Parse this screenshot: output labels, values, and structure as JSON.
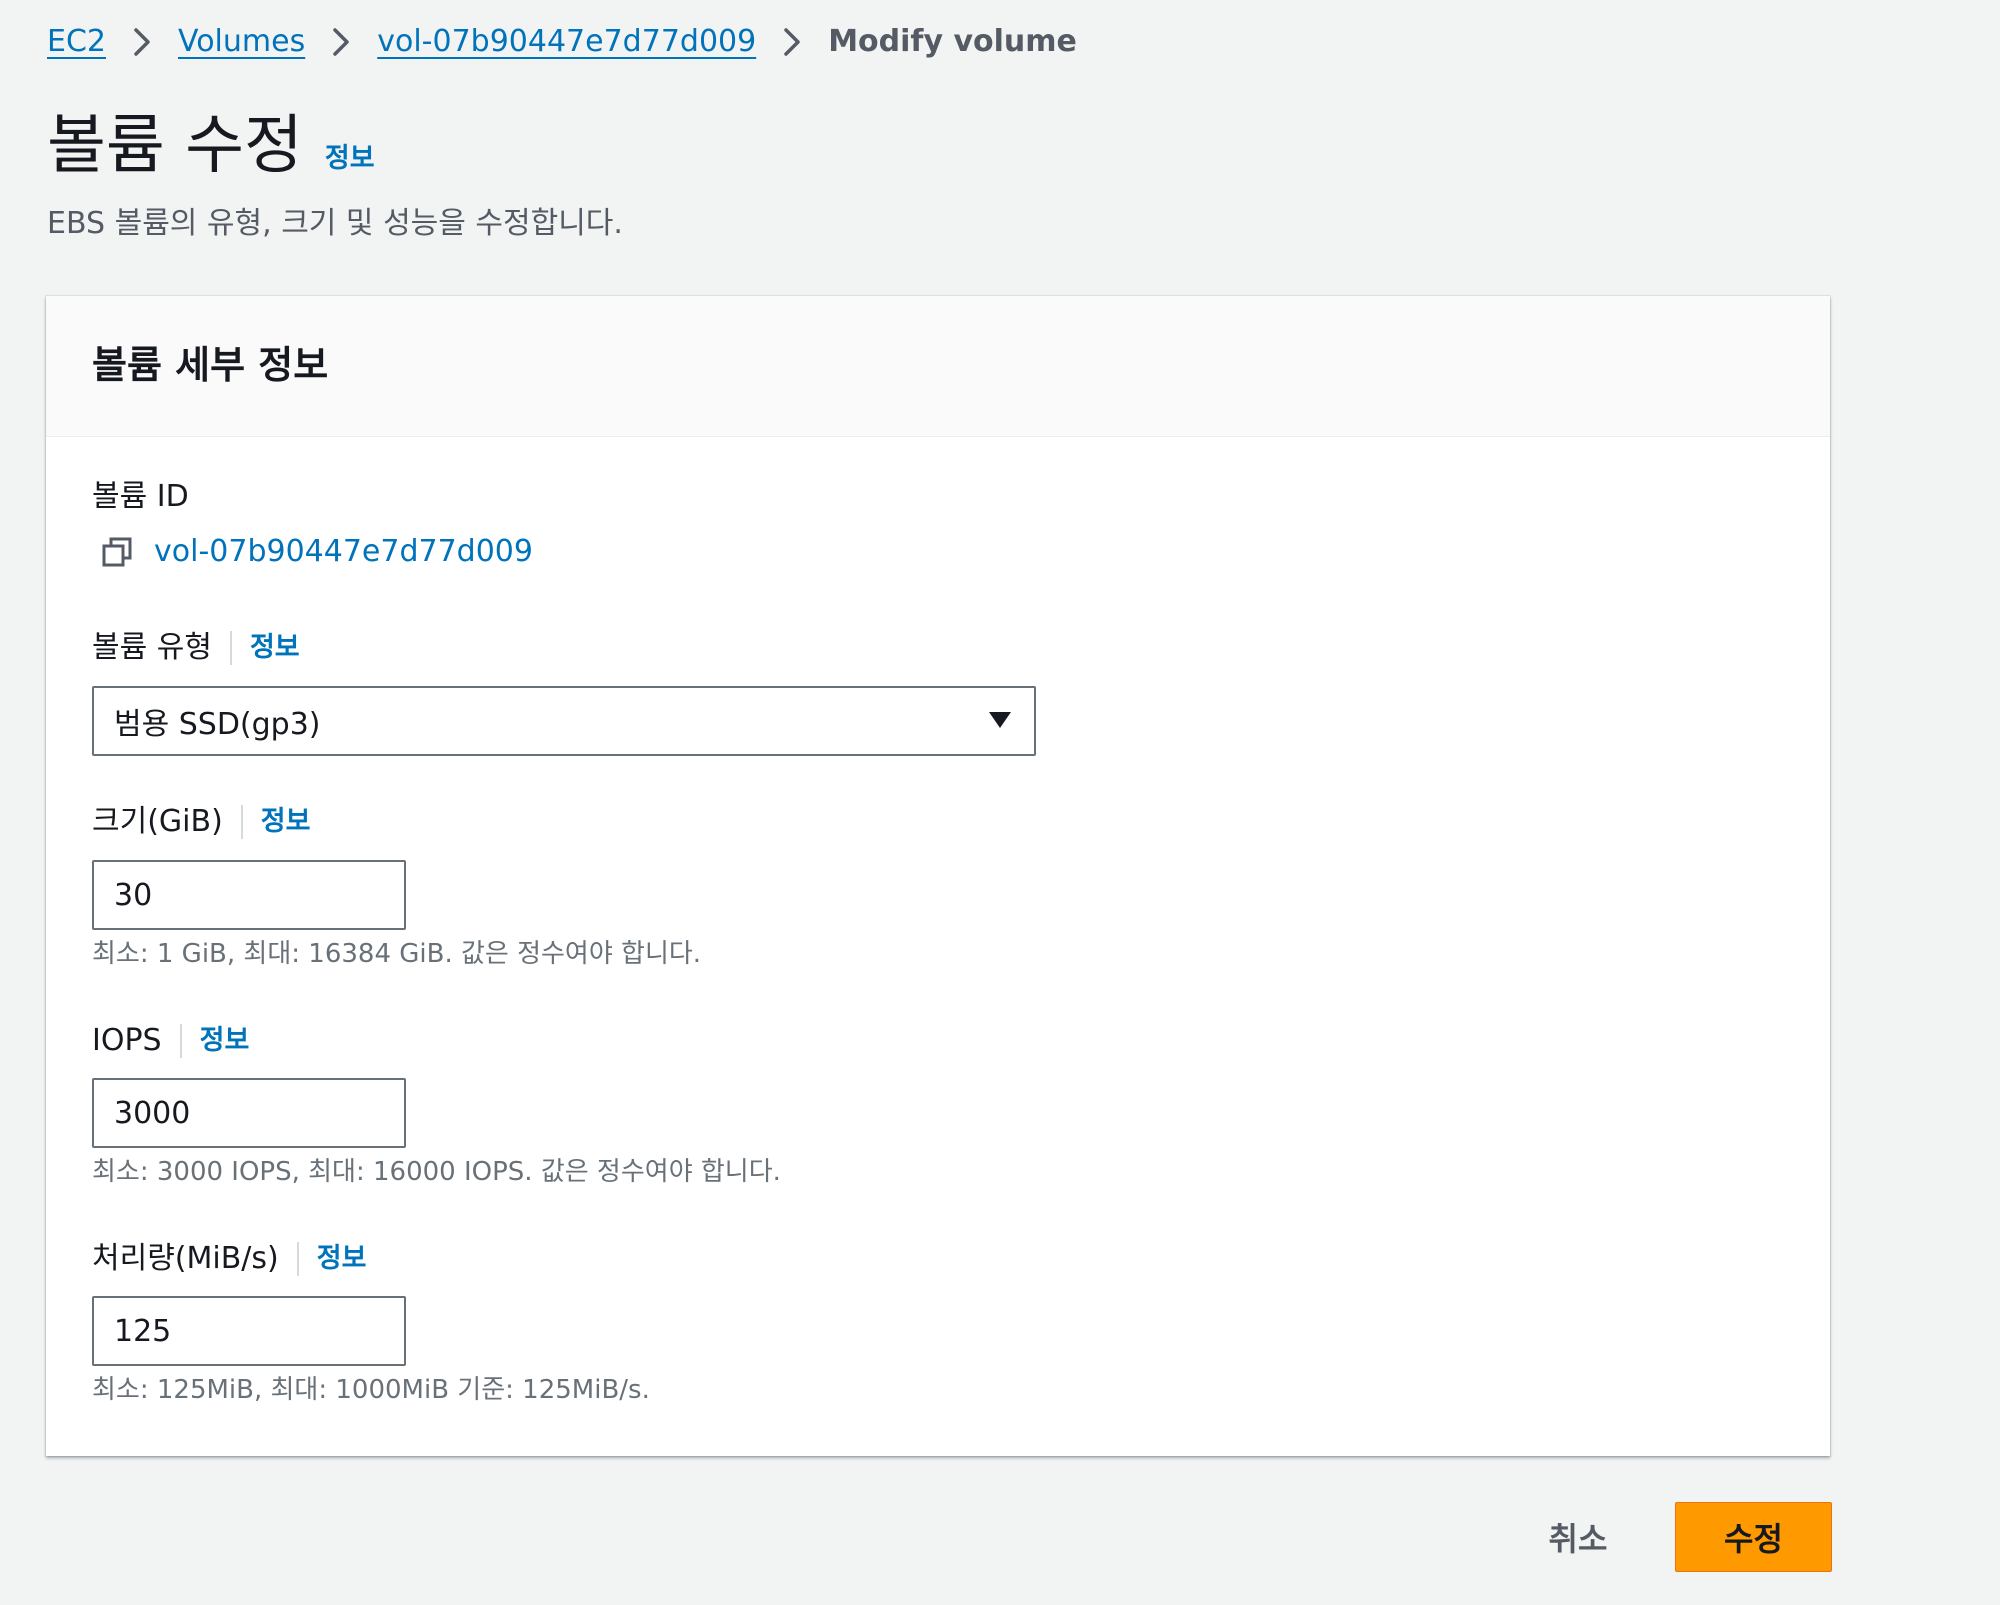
{
  "breadcrumb": {
    "items": [
      "EC2",
      "Volumes",
      "vol-07b90447e7d77d009"
    ],
    "current": "Modify volume"
  },
  "header": {
    "title": "볼륨 수정",
    "info": "정보",
    "description": "EBS 볼륨의 유형, 크기 및 성능을 수정합니다."
  },
  "panel": {
    "title": "볼륨 세부 정보",
    "volume_id": {
      "label": "볼륨 ID",
      "value": "vol-07b90447e7d77d009",
      "icon": "copy-icon"
    },
    "volume_type": {
      "label": "볼륨 유형",
      "info": "정보",
      "selected": "범용 SSD(gp3)"
    },
    "size": {
      "label": "크기(GiB)",
      "info": "정보",
      "value": "30",
      "constraint": "최소: 1 GiB, 최대: 16384 GiB. 값은 정수여야 합니다."
    },
    "iops": {
      "label": "IOPS",
      "info": "정보",
      "value": "3000",
      "constraint": "최소: 3000 IOPS, 최대: 16000 IOPS. 값은 정수여야 합니다."
    },
    "throughput": {
      "label": "처리량(MiB/s)",
      "info": "정보",
      "value": "125",
      "constraint": "최소: 125MiB, 최대: 1000MiB 기준: 125MiB/s."
    }
  },
  "actions": {
    "cancel": "취소",
    "submit": "수정"
  },
  "colors": {
    "background": "#f2f3f3",
    "link": "#0073bb",
    "primary_button": "#ff9900",
    "text": "#16191f"
  }
}
